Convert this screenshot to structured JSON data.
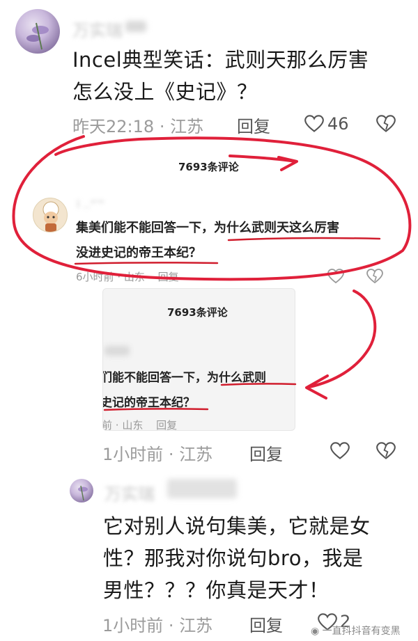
{
  "comment1": {
    "author": "万实瑞",
    "text_line1": "Incel典型笑话：武则天那么厉害",
    "text_line2": "怎么没上《史记》？",
    "time": "昨天22:18",
    "location": "江苏",
    "reply_label": "回复",
    "like_count": "46"
  },
  "screenshot1": {
    "header": "7693条评论",
    "username": "l ..\"ʼ\"",
    "text_line1_a": "集美们能不能回答一下，",
    "text_line1_b": "为什么武则天这么厉害",
    "text_line2": "没进史记的帝王本纪？",
    "time": "6小时前",
    "location": "山东",
    "reply_label": "回复"
  },
  "screenshot2": {
    "header": "7693条评论",
    "text_line1_a": "们能不能回答一下，",
    "text_line1_b": "为什么武则",
    "text_line2": "史记的帝王本纪？",
    "time": "前",
    "location": "山东",
    "reply_label": "回复"
  },
  "comment1_footer": {
    "time": "1小时前",
    "location": "江苏",
    "reply_label": "回复"
  },
  "comment2": {
    "author": "万实瑞",
    "text_line1": "它对别人说句集美，它就是女",
    "text_line2": "性？那我对你说句bro，我是",
    "text_line3": "男性？？？你真是天才！",
    "time": "1小时前",
    "location": "江苏",
    "reply_label": "回复",
    "like_count": "2"
  },
  "watermark": "一直抖抖音有变黑",
  "colors": {
    "annotation_red": "#e0203a",
    "underline_red": "#d01c2c",
    "meta_gray": "#9b9b9b"
  }
}
